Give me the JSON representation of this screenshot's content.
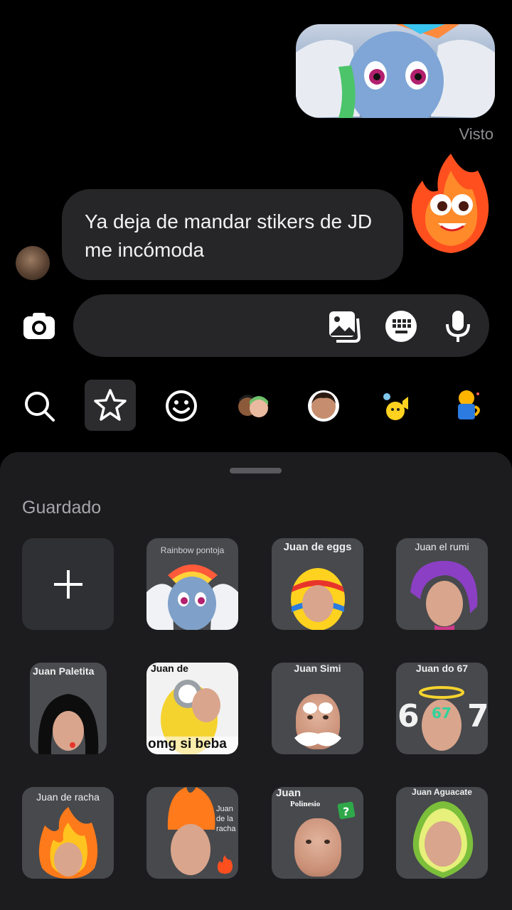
{
  "chat": {
    "sent_sticker_caption": "",
    "seen_label": "Visto",
    "received_message": "Ya deja de mandar stikers de JD me incómoda"
  },
  "composer": {
    "placeholder": ""
  },
  "tabs": [
    {
      "name": "search"
    },
    {
      "name": "favorites",
      "active": true
    },
    {
      "name": "emoji"
    },
    {
      "name": "avatars"
    },
    {
      "name": "my-avatar"
    },
    {
      "name": "stickers-a"
    },
    {
      "name": "stickers-b"
    }
  ],
  "sheet": {
    "section_title": "Guardado",
    "tiles": [
      {
        "caption": ""
      },
      {
        "caption": "Rainbow pontoja"
      },
      {
        "caption": "Juan de eggs"
      },
      {
        "caption": "Juan el rumi"
      },
      {
        "caption": "Juan Paletita"
      },
      {
        "caption": "Juan de",
        "subcaption": "omg si beba"
      },
      {
        "caption": "Juan Simi"
      },
      {
        "caption": "Juan do 67"
      },
      {
        "caption": "Juan de racha"
      },
      {
        "caption": "Juan de la racha"
      },
      {
        "caption": "Juan",
        "subcaption": "Polinesio"
      },
      {
        "caption": "Juan Aguacate"
      }
    ]
  },
  "colors": {
    "bubble": "#262628",
    "sheet": "#1c1c1e",
    "tile": "#47494d"
  }
}
